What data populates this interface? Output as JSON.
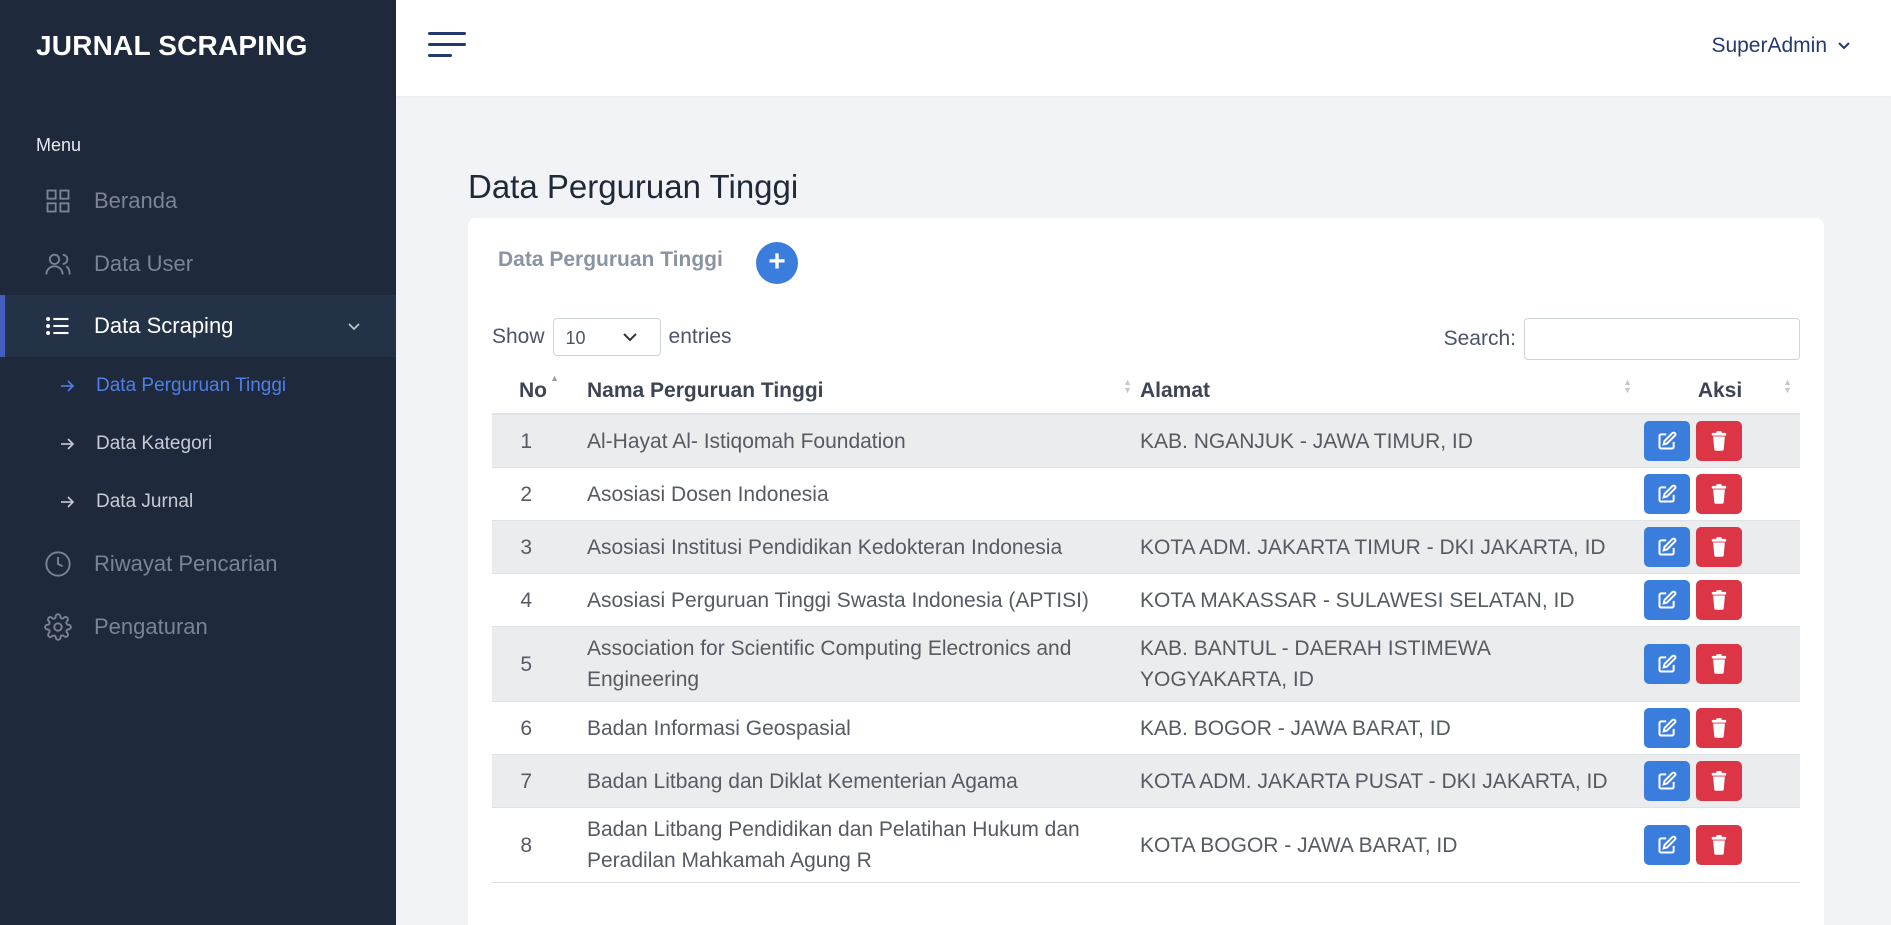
{
  "app": {
    "brand": "JURNAL SCRAPING"
  },
  "sidebar": {
    "menu_title": "Menu",
    "items": [
      {
        "label": "Beranda",
        "icon": "grid-icon"
      },
      {
        "label": "Data User",
        "icon": "users-icon"
      },
      {
        "label": "Data Scraping",
        "icon": "list-icon",
        "active": true
      },
      {
        "label": "Riwayat Pencarian",
        "icon": "clock-icon"
      },
      {
        "label": "Pengaturan",
        "icon": "gear-icon"
      }
    ],
    "subitems": [
      {
        "label": "Data Perguruan Tinggi",
        "active": true
      },
      {
        "label": "Data Kategori"
      },
      {
        "label": "Data Jurnal"
      }
    ]
  },
  "topbar": {
    "user": "SuperAdmin"
  },
  "page": {
    "title": "Data Perguruan Tinggi"
  },
  "card": {
    "title": "Data Perguruan Tinggi",
    "add_icon": "+",
    "show_label": "Show",
    "entries_value": "10",
    "entries_label": "entries",
    "search_label": "Search:"
  },
  "table": {
    "headers": [
      "No",
      "Nama Perguruan Tinggi",
      "Alamat",
      "Aksi"
    ],
    "rows": [
      {
        "no": "1",
        "name": "Al-Hayat Al- Istiqomah Foundation",
        "address": "KAB. NGANJUK - JAWA TIMUR, ID"
      },
      {
        "no": "2",
        "name": "Asosiasi Dosen Indonesia",
        "address": ""
      },
      {
        "no": "3",
        "name": "Asosiasi Institusi Pendidikan Kedokteran Indonesia",
        "address": "KOTA ADM. JAKARTA TIMUR - DKI JAKARTA, ID"
      },
      {
        "no": "4",
        "name": "Asosiasi Perguruan Tinggi Swasta Indonesia (APTISI)",
        "address": "KOTA MAKASSAR - SULAWESI SELATAN, ID"
      },
      {
        "no": "5",
        "name": "Association for Scientific Computing Electronics and Engineering",
        "address": "KAB. BANTUL - DAERAH ISTIMEWA YOGYAKARTA, ID"
      },
      {
        "no": "6",
        "name": "Badan Informasi Geospasial",
        "address": "KAB. BOGOR - JAWA BARAT, ID"
      },
      {
        "no": "7",
        "name": "Badan Litbang dan Diklat Kementerian Agama",
        "address": "KOTA ADM. JAKARTA PUSAT - DKI JAKARTA, ID"
      },
      {
        "no": "8",
        "name": "Badan Litbang Pendidikan dan Pelatihan Hukum dan Peradilan Mahkamah Agung R",
        "address": "KOTA BOGOR - JAWA BARAT, ID"
      }
    ]
  },
  "colors": {
    "sidebar_bg": "#1e293b",
    "accent": "#435ebe",
    "edit": "#3b7ddd",
    "delete": "#dc3545",
    "active_link": "#4f7fe6"
  }
}
